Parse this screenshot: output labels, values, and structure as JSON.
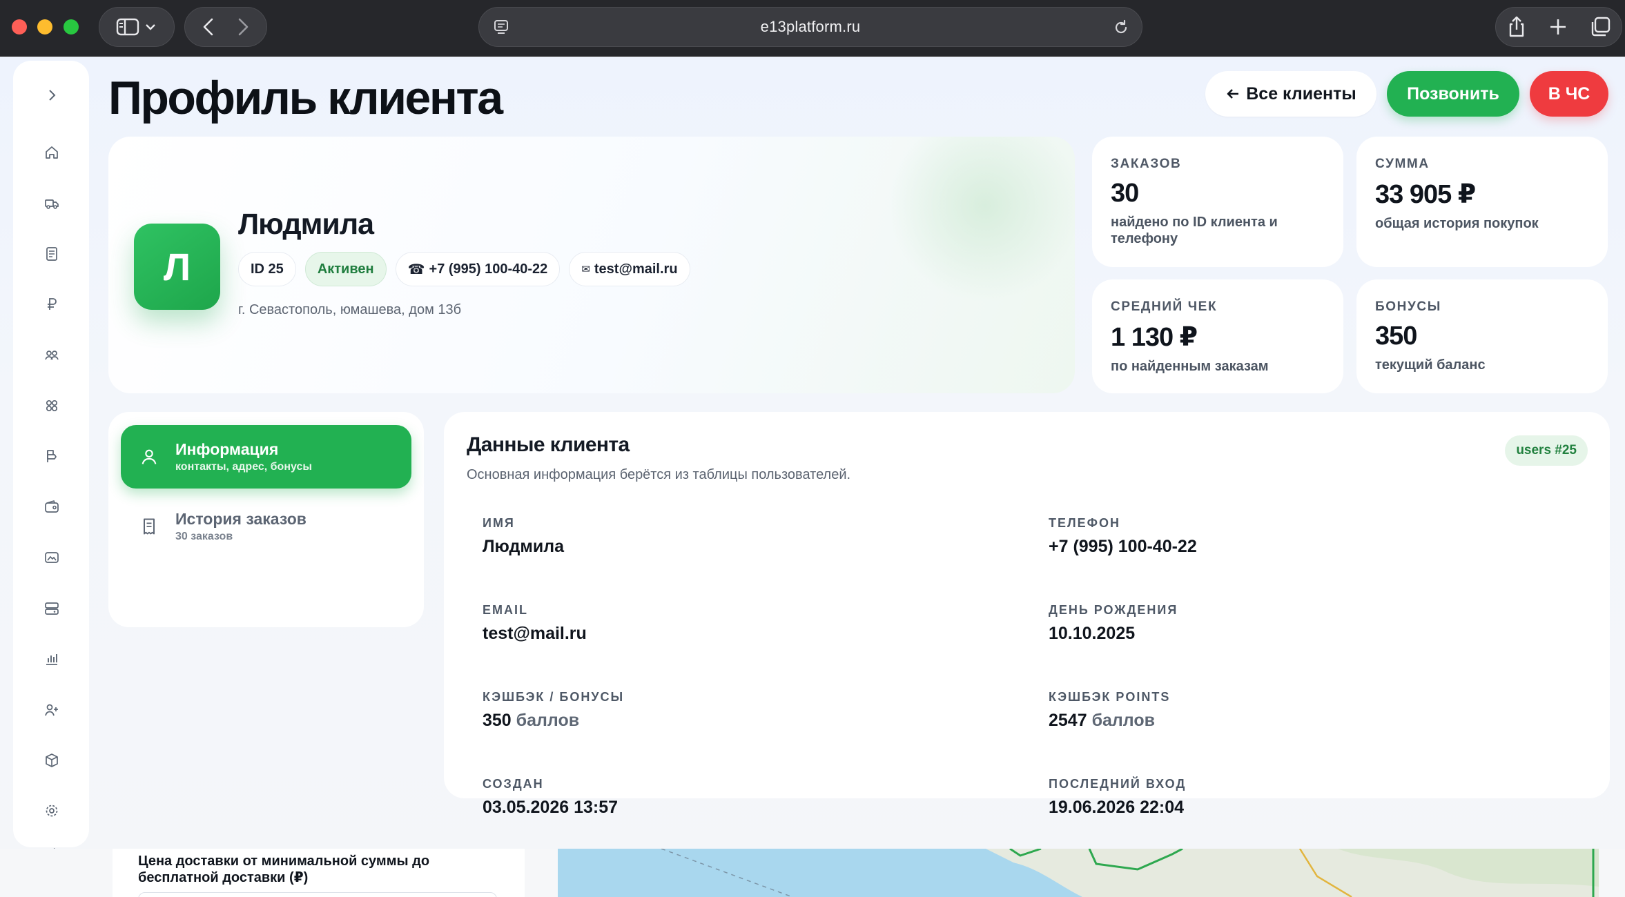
{
  "browser": {
    "url": "e13platform.ru"
  },
  "page": {
    "title": "Профиль клиента"
  },
  "header_actions": {
    "all_clients": "Все клиенты",
    "call": "Позвонить",
    "blacklist": "В ЧС"
  },
  "client": {
    "avatar_letter": "Л",
    "name": "Людмила",
    "id_chip": "ID 25",
    "status": "Активен",
    "phone_chip": "+7 (995) 100-40-22",
    "email_chip": "test@mail.ru",
    "address": "г. Севастополь, юмашева, дом 13б"
  },
  "stats": [
    {
      "label": "ЗАКАЗОВ",
      "value": "30",
      "sub": "найдено по ID клиента и телефону"
    },
    {
      "label": "СУММА",
      "value": "33 905 ₽",
      "sub": "общая история покупок"
    },
    {
      "label": "СРЕДНИЙ ЧЕК",
      "value": "1 130 ₽",
      "sub": "по найденным заказам"
    },
    {
      "label": "БОНУСЫ",
      "value": "350",
      "sub": "текущий баланс"
    }
  ],
  "tabs": [
    {
      "title": "Информация",
      "sub": "контакты, адрес, бонусы",
      "active": true
    },
    {
      "title": "История заказов",
      "sub": "30 заказов",
      "active": false
    }
  ],
  "details": {
    "title": "Данные клиента",
    "subtitle": "Основная информация берётся из таблицы пользователей.",
    "tag": "users #25",
    "fields": [
      {
        "label": "ИМЯ",
        "value": "Людмила"
      },
      {
        "label": "ТЕЛЕФОН",
        "value": "+7 (995) 100-40-22"
      },
      {
        "label": "EMAIL",
        "value": "test@mail.ru"
      },
      {
        "label": "ДЕНЬ РОЖДЕНИЯ",
        "value": "10.10.2025"
      },
      {
        "label": "КЭШБЭК / БОНУСЫ",
        "value": "350",
        "unit": "баллов"
      },
      {
        "label": "КЭШБЭК POINTS",
        "value": "2547",
        "unit": "баллов"
      },
      {
        "label": "СОЗДАН",
        "value": "03.05.2026 13:57"
      },
      {
        "label": "ПОСЛЕДНИЙ ВХОД",
        "value": "19.06.2026 22:04"
      }
    ]
  },
  "bottom": {
    "delivery_label": "Цена доставки от минимальной суммы до бесплатной доставки (₽)"
  },
  "nav_icons": [
    "chevron-right-icon",
    "home-icon",
    "truck-icon",
    "document-icon",
    "ruble-icon",
    "users-icon",
    "grid-icon",
    "tag-icon",
    "wallet-icon",
    "image-icon",
    "server-icon",
    "bar-chart-icon",
    "user-plus-icon",
    "box-icon",
    "settings-icon"
  ],
  "colors": {
    "accent_green": "#22b152",
    "danger_red": "#ef3b3f",
    "chrome_bg": "#26272b"
  }
}
